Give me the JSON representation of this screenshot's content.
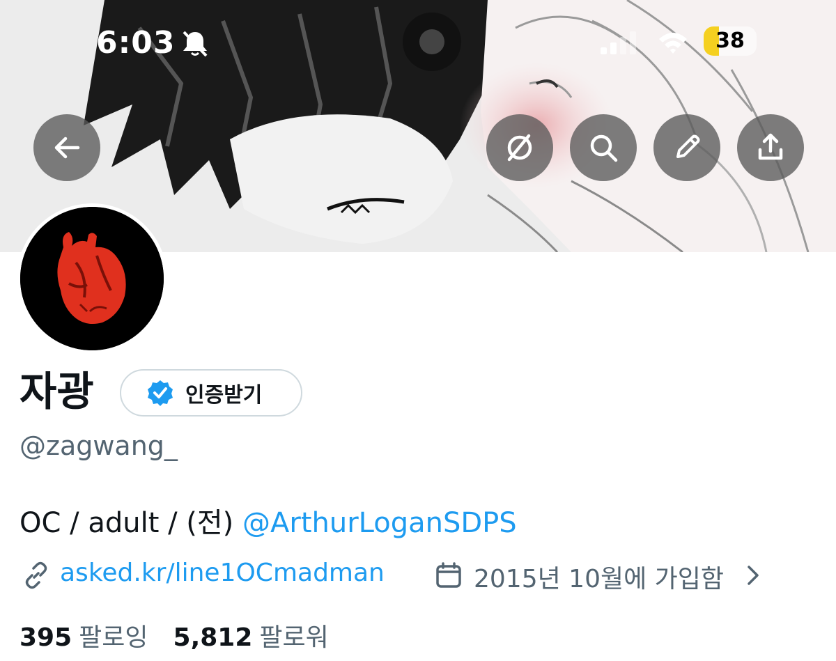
{
  "status_bar": {
    "time": "6:03",
    "battery_level": "38",
    "icons": [
      "bell-slash-icon",
      "cellular-signal-icon",
      "wifi-icon",
      "battery-icon"
    ]
  },
  "header": {
    "buttons": [
      {
        "name": "back-button",
        "icon": "arrow-left-icon"
      },
      {
        "name": "grok-button",
        "icon": "grok-icon"
      },
      {
        "name": "search-button",
        "icon": "search-icon"
      },
      {
        "name": "edit-button",
        "icon": "pencil-icon"
      },
      {
        "name": "share-button",
        "icon": "share-icon"
      }
    ]
  },
  "profile": {
    "display_name": "자광",
    "verify_label": "인증받기",
    "handle": "@zagwang_",
    "bio_text": "OC / adult / (전) ",
    "bio_mention": "@ArthurLoganSDPS",
    "website": "asked.kr/line1OCmadman",
    "joined": "2015년 10월에 가입함",
    "following_count": "395",
    "following_label": "팔로잉",
    "followers_count": "5,812",
    "followers_label": "팔로워"
  },
  "colors": {
    "accent": "#1d9bf0",
    "secondary_text": "#536471",
    "primary_text": "#0f1419",
    "verify_badge": "#1d9bf0",
    "battery_fill": "#f5d020"
  }
}
